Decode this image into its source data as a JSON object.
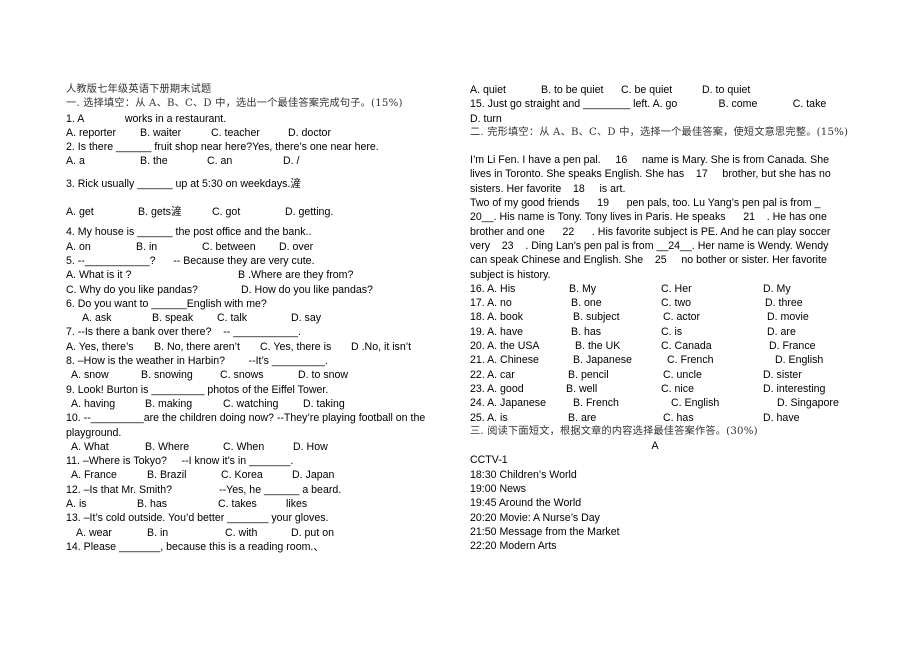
{
  "title": "人教版七年级英语下册期末试题",
  "section1": {
    "heading": "一. 选择填空：从 A、B、C、D 中，选出一个最佳答案完成句子。(15%)",
    "questions": [
      {
        "q": "1. A              works in a restaurant.",
        "options": [
          "A. reporter",
          "B. waiter",
          "C. teacher",
          "D. doctor"
        ]
      },
      {
        "q": "2. Is there ______ fruit shop near here?Yes, there’s one near here.",
        "options": [
          "A. a",
          "B. the",
          "C. an",
          "D. /"
        ]
      },
      {
        "q": "3. Rick usually ______ up at 5:30 on weekdays.滻",
        "options": [
          "A. get",
          "B. gets滻",
          "C. got",
          "D. getting."
        ]
      },
      {
        "q": "4. My house is ______ the post office and the bank..",
        "options": [
          "A. on",
          "B. in",
          "C. between",
          "D. over"
        ]
      },
      {
        "q": "5. --___________?      -- Because they are very cute.",
        "options": [
          "A. What is it ?",
          "B .Where are they from?",
          "C. Why do you like pandas?",
          "D. How do you like pandas?"
        ]
      },
      {
        "q": "6. Do you want to ______English with me?",
        "options": [
          "A. ask",
          "B. speak",
          "C. talk",
          "D. say"
        ]
      },
      {
        "q": "7. --Is there a bank over there?    -- ___________.",
        "options": [
          "A. Yes, there’s",
          "B. No, there aren’t",
          "C. Yes, there is",
          "D .No, it isn’t"
        ]
      },
      {
        "q": "8. –How is the weather in Harbin?        --It’s _________.",
        "options": [
          "A. snow",
          "B. snowing",
          "C. snows",
          "D. to snow"
        ]
      },
      {
        "q": "9. Look! Burton is _________ photos of the Eiffel Tower.",
        "options": [
          "A. having",
          "B. making",
          "C. watching",
          "D. taking"
        ]
      },
      {
        "q": "10. --_________are the children doing now?     --They’re playing football on the playground.",
        "options": [
          "A. What",
          "B. Where",
          "C. When",
          "D. How"
        ]
      },
      {
        "q": "11. –Where is Tokyo?     --I know it’s in _______.",
        "options": [
          "A. France",
          "B. Brazil",
          "C. Korea",
          "D. Japan"
        ]
      },
      {
        "q": "12. –Is that Mr. Smith?                --Yes, he ______ a beard.",
        "options": [
          "A. is",
          "B. has",
          "C. takes",
          "likes"
        ]
      },
      {
        "q": "13. –It’s cold outside. You’d better _______ your gloves.",
        "options": [
          "A. wear",
          "B. in",
          "C. with",
          "D. put on"
        ]
      },
      {
        "q": "14. Please _______, because this is a reading room.、",
        "options": [
          "A. quiet",
          "B. to be quiet",
          "C. be quiet",
          "D. to quiet"
        ]
      },
      {
        "q": "15. Just go straight and ________ left. A. go              B. come            C. take",
        "q2": "D. turn"
      }
    ]
  },
  "section2": {
    "heading": "二. 完形填空：从 A、B、C、D 中，选择一个最佳答案，使短文意思完整。(15%)",
    "passage": [
      "I’m Li Fen. I have a pen pal.     16     name is Mary. She is from Canada. She",
      "lives in Toronto. She speaks English. She has    17     brother, but she has no",
      "sisters. Her favorite    18     is art.",
      "Two of my good friends      19      pen pals, too. Lu Yang’s pen pal is from _",
      "20__. His name is Tony. Tony lives in Paris. He speaks      21    . He has one",
      "brother and one      22      . His favorite subject is PE. And he can play soccer",
      "very    23    . Ding Lan’s pen pal is from __24__. Her name is Wendy. Wendy",
      "can speak Chinese and English. She    25     no bother or sister. Her favorite",
      "subject is history."
    ],
    "choices": [
      [
        "16. A. His",
        "B. My",
        "C. Her",
        "D. My"
      ],
      [
        "17. A. no",
        "B. one",
        "C. two",
        "D. three"
      ],
      [
        "18. A. book",
        "B. subject",
        "C. actor",
        "D. movie"
      ],
      [
        "19. A. have",
        "B. has",
        "C. is",
        "D. are"
      ],
      [
        "20. A. the USA",
        "B. the UK",
        "C. Canada",
        "D. France"
      ],
      [
        "21. A. Chinese",
        "B. Japanese",
        "C. French",
        "D. English"
      ],
      [
        "22. A. car",
        "B. pencil",
        "C. uncle",
        "D. sister"
      ],
      [
        "23. A. good",
        "B. well",
        "C. nice",
        "D. interesting"
      ],
      [
        "24. A. Japanese",
        "B. French",
        "C. English",
        "D. Singapore"
      ],
      [
        "25. A. is",
        "B. are",
        "C. has",
        "D. have"
      ]
    ]
  },
  "section3": {
    "heading": "三. 阅读下面短文，根据文章的内容选择最佳答案作答。(30%)",
    "part": "A",
    "channel": "CCTV-1",
    "schedule": [
      "18:30 Children’s World",
      "19:00 News",
      "19:45 Around the World",
      "20:20 Movie: A Nurse’s Day",
      "21:50 Message from the Market",
      "22:20 Modern Arts"
    ]
  }
}
